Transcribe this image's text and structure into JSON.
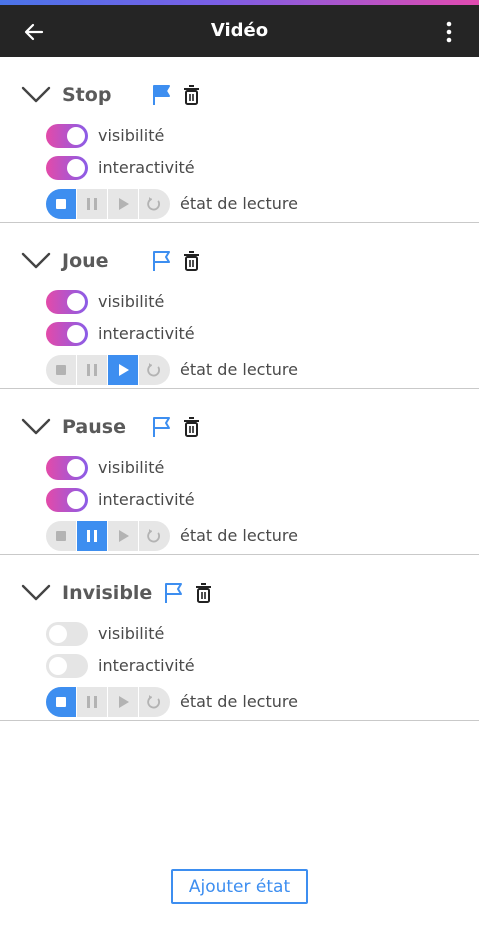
{
  "header": {
    "title": "Vidéo",
    "back_icon": "arrow-left-icon",
    "menu_icon": "more-vertical-icon"
  },
  "colors": {
    "header_bg": "#252525",
    "accent": "#3d8ef0",
    "toggle_on_start": "#e34aa9",
    "toggle_on_end": "#8a5de8",
    "toggle_off": "#e5e5e5",
    "player_bg": "#e6e6e6"
  },
  "states": [
    {
      "name": "Stop",
      "flag": "filled",
      "visibility_label": "visibilité",
      "visibility_on": true,
      "interactivity_label": "interactivité",
      "interactivity_on": true,
      "playback_label": "état de lecture",
      "playback_active": "stop"
    },
    {
      "name": "Joue",
      "flag": "outline",
      "visibility_label": "visibilité",
      "visibility_on": true,
      "interactivity_label": "interactivité",
      "interactivity_on": true,
      "playback_label": "état de lecture",
      "playback_active": "play"
    },
    {
      "name": "Pause",
      "flag": "outline",
      "visibility_label": "visibilité",
      "visibility_on": true,
      "interactivity_label": "interactivité",
      "interactivity_on": true,
      "playback_label": "état de lecture",
      "playback_active": "pause"
    },
    {
      "name": "Invisible",
      "flag": "outline",
      "visibility_label": "visibilité",
      "visibility_on": false,
      "interactivity_label": "interactivité",
      "interactivity_on": false,
      "playback_label": "état de lecture",
      "playback_active": "stop"
    }
  ],
  "player_buttons": [
    "stop",
    "pause",
    "play",
    "replay"
  ],
  "footer": {
    "add_state_label": "Ajouter état"
  }
}
